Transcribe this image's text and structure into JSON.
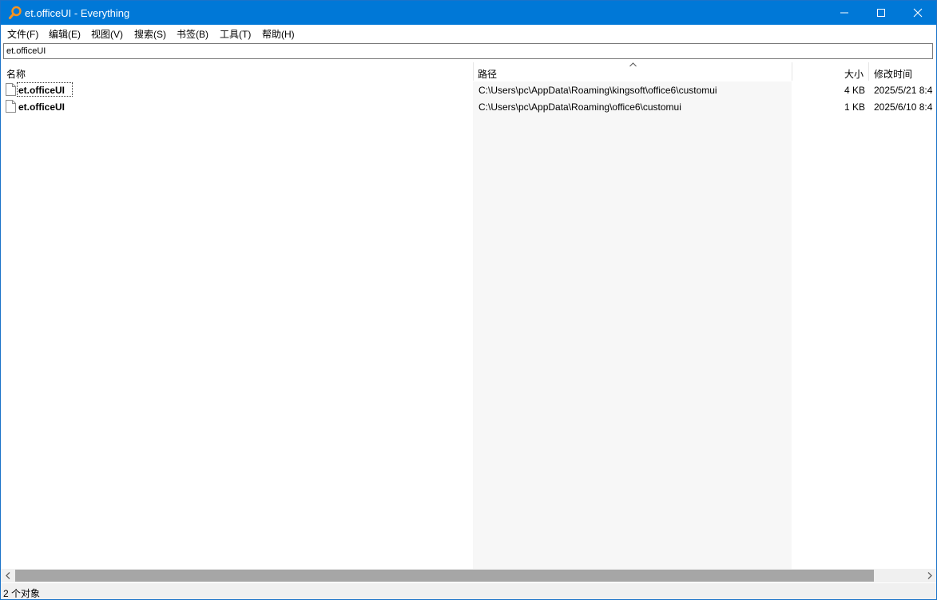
{
  "window": {
    "title": "et.officeUI - Everything",
    "accent_color": "#0078d7"
  },
  "menu": {
    "items": [
      {
        "label": "文件(F)"
      },
      {
        "label": "编辑(E)"
      },
      {
        "label": "视图(V)"
      },
      {
        "label": "搜索(S)"
      },
      {
        "label": "书签(B)"
      },
      {
        "label": "工具(T)"
      },
      {
        "label": "帮助(H)"
      }
    ]
  },
  "search": {
    "value": "et.officeUI"
  },
  "columns": {
    "name": "名称",
    "path": "路径",
    "size": "大小",
    "modified": "修改时间",
    "sorted_by": "路径",
    "sort_direction": "ascending"
  },
  "results": [
    {
      "name": "et.officeUI",
      "path": "C:\\Users\\pc\\AppData\\Roaming\\kingsoft\\office6\\customui",
      "size": "4 KB",
      "modified": "2025/5/21 8:4",
      "icon": "file-icon"
    },
    {
      "name": "et.officeUI",
      "path": "C:\\Users\\pc\\AppData\\Roaming\\office6\\customui",
      "size": "1 KB",
      "modified": "2025/6/10 8:4",
      "icon": "file-icon"
    }
  ],
  "status": {
    "text": "2 个对象"
  }
}
